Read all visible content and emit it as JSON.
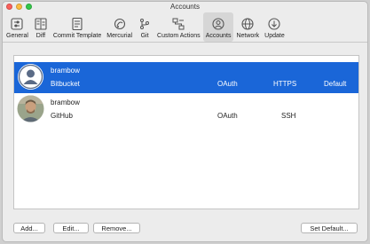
{
  "window": {
    "title": "Accounts"
  },
  "toolbar": {
    "items": [
      {
        "label": "General",
        "icon": "general-switch-icon"
      },
      {
        "label": "Diff",
        "icon": "diff-icon"
      },
      {
        "label": "Commit Template",
        "icon": "commit-template-icon"
      },
      {
        "label": "Mercurial",
        "icon": "mercurial-icon"
      },
      {
        "label": "Git",
        "icon": "git-icon"
      },
      {
        "label": "Custom Actions",
        "icon": "custom-actions-icon"
      },
      {
        "label": "Accounts",
        "icon": "accounts-icon",
        "selected": true
      },
      {
        "label": "Network",
        "icon": "network-globe-icon"
      },
      {
        "label": "Update",
        "icon": "update-icon"
      }
    ]
  },
  "accounts": [
    {
      "user": "brambow",
      "host": "Bitbucket",
      "auth": "OAuth",
      "protocol": "HTTPS",
      "default": "Default",
      "selected": true,
      "avatar": "default-avatar-icon"
    },
    {
      "user": "brambow",
      "host": "GitHub",
      "auth": "OAuth",
      "protocol": "SSH",
      "default": "",
      "selected": false,
      "avatar": "user-photo-avatar"
    }
  ],
  "buttons": {
    "add": "Add...",
    "edit": "Edit...",
    "remove": "Remove...",
    "set_default": "Set Default..."
  },
  "colors": {
    "selection": "#1a66d8",
    "window_bg": "#ececec",
    "close": "#fc605b",
    "minimize": "#fdbc40",
    "zoom": "#34c84a"
  }
}
